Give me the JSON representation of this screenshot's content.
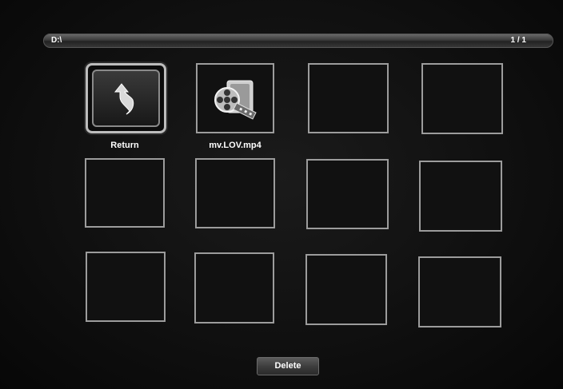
{
  "header": {
    "path": "D:\\",
    "page_indicator": "1 / 1"
  },
  "grid": {
    "items": [
      {
        "label": "Return",
        "icon": "return-arrow-icon",
        "selected": true
      },
      {
        "label": "mv.LOV.mp4",
        "icon": "video-file-icon",
        "selected": false
      }
    ]
  },
  "footer": {
    "delete_label": "Delete"
  }
}
